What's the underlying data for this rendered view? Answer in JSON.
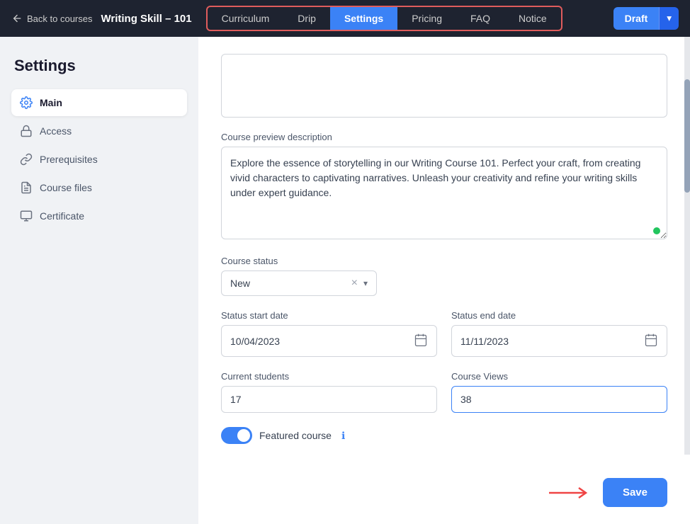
{
  "topNav": {
    "backLabel": "Back to courses",
    "courseTitle": "Writing Skill – 101",
    "tabs": [
      {
        "id": "curriculum",
        "label": "Curriculum",
        "active": false
      },
      {
        "id": "drip",
        "label": "Drip",
        "active": false
      },
      {
        "id": "settings",
        "label": "Settings",
        "active": true
      },
      {
        "id": "pricing",
        "label": "Pricing",
        "active": false
      },
      {
        "id": "faq",
        "label": "FAQ",
        "active": false
      },
      {
        "id": "notice",
        "label": "Notice",
        "active": false
      }
    ],
    "draftLabel": "Draft"
  },
  "sidebar": {
    "title": "Settings",
    "items": [
      {
        "id": "main",
        "label": "Main",
        "active": true,
        "icon": "gear"
      },
      {
        "id": "access",
        "label": "Access",
        "active": false,
        "icon": "lock"
      },
      {
        "id": "prerequisites",
        "label": "Prerequisites",
        "active": false,
        "icon": "link"
      },
      {
        "id": "course-files",
        "label": "Course files",
        "active": false,
        "icon": "file"
      },
      {
        "id": "certificate",
        "label": "Certificate",
        "active": false,
        "icon": "badge"
      }
    ]
  },
  "form": {
    "previewDescLabel": "Course preview description",
    "previewDescValue": "Explore the essence of storytelling in our Writing Course 101. Perfect your craft, from creating vivid characters to captivating narratives. Unleash your creativity and refine your writing skills under expert guidance.",
    "courseStatusLabel": "Course status",
    "courseStatusValue": "New",
    "statusStartDateLabel": "Status start date",
    "statusStartDateValue": "10/04/2023",
    "statusEndDateLabel": "Status end date",
    "statusEndDateValue": "11/11/2023",
    "currentStudentsLabel": "Current students",
    "currentStudentsValue": "17",
    "courseViewsLabel": "Course Views",
    "courseViewsValue": "38",
    "featuredCourseLabel": "Featured course",
    "saveLabel": "Save"
  }
}
